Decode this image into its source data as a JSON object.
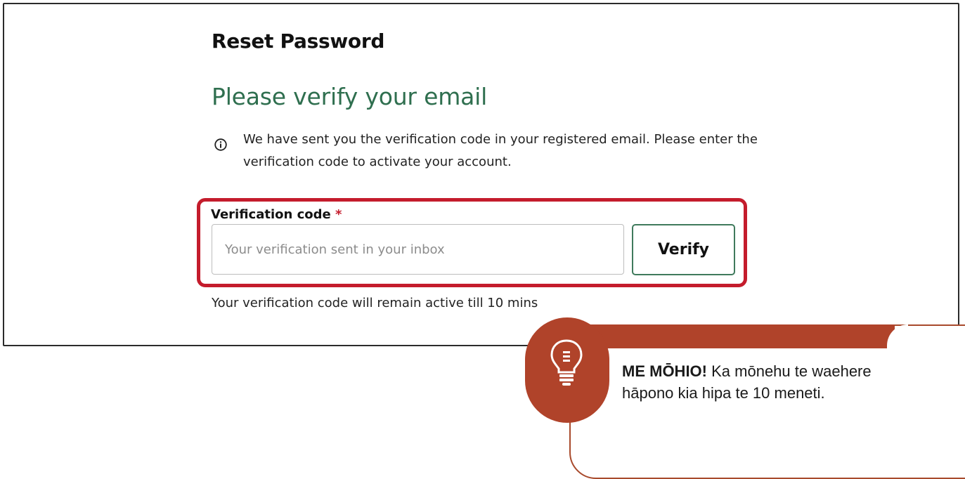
{
  "page": {
    "title": "Reset Password",
    "heading": "Please verify your email",
    "info_text": "We have sent you the verification code in your registered email. Please enter the verification code to activate your account.",
    "field_label": "Verification code",
    "required_mark": "*",
    "input_placeholder": "Your verification sent in your inbox",
    "input_value": "",
    "verify_label": "Verify",
    "hint": "Your verification code will remain active till 10 mins"
  },
  "tip": {
    "icon": "lightbulb-icon",
    "lead": "ME MŌHIO!",
    "text": "Ka mōnehu te waehere hāpono kia hipa te 10 meneti."
  },
  "colors": {
    "heading": "#2f6f4f",
    "highlight": "#c41c2c",
    "button_border": "#3f7a5c",
    "tip_accent": "#b0432a"
  }
}
